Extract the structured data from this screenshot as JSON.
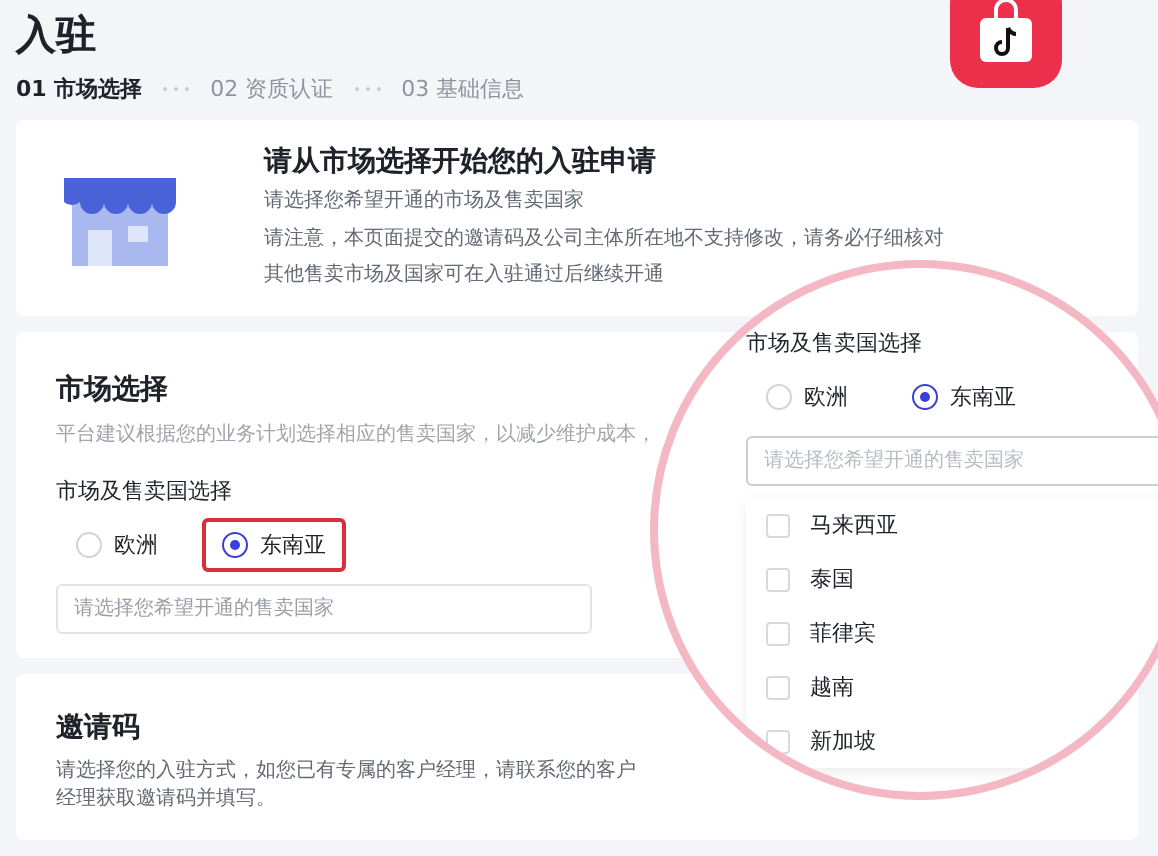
{
  "page": {
    "title": "入驻"
  },
  "steps": [
    {
      "label": "01 市场选择",
      "selected": true
    },
    {
      "label": "02 资质认证",
      "selected": false
    },
    {
      "label": "03 基础信息",
      "selected": false
    }
  ],
  "intro": {
    "title": "请从市场选择开始您的入驻申请",
    "lines": [
      "请选择您希望开通的市场及售卖国家",
      "请注意，本页面提交的邀请码及公司主体所在地不支持修改，请务必仔细核对",
      "其他售卖市场及国家可在入驻通过后继续开通"
    ]
  },
  "market": {
    "title": "市场选择",
    "description": "平台建议根据您的业务计划选择相应的售卖国家，以减少维护成本，",
    "field_label": "市场及售卖国选择",
    "options": [
      {
        "label": "欧洲",
        "selected": false
      },
      {
        "label": "东南亚",
        "selected": true
      }
    ],
    "placeholder": "请选择您希望开通的售卖国家"
  },
  "invite": {
    "title": "邀请码",
    "description": "请选择您的入驻方式，如您已有专属的客户经理，请联系您的客户经理获取邀请码并填写。"
  },
  "magnifier": {
    "field_label": "市场及售卖国选择",
    "options": [
      {
        "label": "欧洲",
        "selected": false
      },
      {
        "label": "东南亚",
        "selected": true
      }
    ],
    "placeholder": "请选择您希望开通的售卖国家",
    "countries": [
      {
        "label": "马来西亚",
        "checked": false
      },
      {
        "label": "泰国",
        "checked": false
      },
      {
        "label": "菲律宾",
        "checked": false
      },
      {
        "label": "越南",
        "checked": false
      },
      {
        "label": "新加坡",
        "checked": false
      }
    ]
  }
}
